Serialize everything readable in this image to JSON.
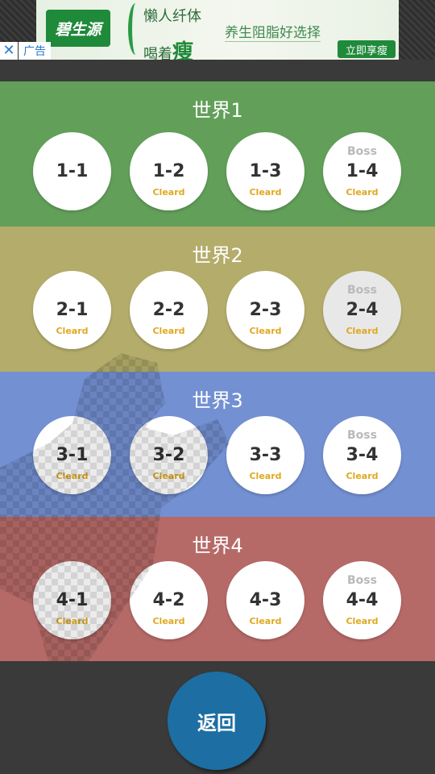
{
  "ad": {
    "brand": "碧生源",
    "line1": "懒人纤体",
    "line2_prefix": "喝着",
    "line2_highlight": "瘦",
    "slogan": "养生阻脂好选择",
    "cta": "立即享瘦",
    "close_glyph": "✕",
    "label": "广告"
  },
  "colors": {
    "world1": "#62a05a",
    "world2": "#b4ac6a",
    "world3": "#7390d2",
    "world4": "#b66a68",
    "back_button": "#1d6ea3",
    "cleared_text": "#e0a81e"
  },
  "worlds": [
    {
      "title": "世界1",
      "levels": [
        {
          "label": "1-1",
          "boss": "",
          "status": ""
        },
        {
          "label": "1-2",
          "boss": "",
          "status": "Cleard"
        },
        {
          "label": "1-3",
          "boss": "",
          "status": "Cleard"
        },
        {
          "label": "1-4",
          "boss": "Boss",
          "status": "Cleard"
        }
      ]
    },
    {
      "title": "世界2",
      "levels": [
        {
          "label": "2-1",
          "boss": "",
          "status": "Cleard"
        },
        {
          "label": "2-2",
          "boss": "",
          "status": "Cleard"
        },
        {
          "label": "2-3",
          "boss": "",
          "status": "Cleard"
        },
        {
          "label": "2-4",
          "boss": "Boss",
          "status": "Cleard"
        }
      ]
    },
    {
      "title": "世界3",
      "levels": [
        {
          "label": "3-1",
          "boss": "",
          "status": "Cleard"
        },
        {
          "label": "3-2",
          "boss": "",
          "status": "Cleard"
        },
        {
          "label": "3-3",
          "boss": "",
          "status": "Cleard"
        },
        {
          "label": "3-4",
          "boss": "Boss",
          "status": "Cleard"
        }
      ]
    },
    {
      "title": "世界4",
      "levels": [
        {
          "label": "4-1",
          "boss": "",
          "status": "Cleard"
        },
        {
          "label": "4-2",
          "boss": "",
          "status": "Cleard"
        },
        {
          "label": "4-3",
          "boss": "",
          "status": "Cleard"
        },
        {
          "label": "4-4",
          "boss": "Boss",
          "status": "Cleard"
        }
      ]
    }
  ],
  "back_button": {
    "label": "返回"
  }
}
